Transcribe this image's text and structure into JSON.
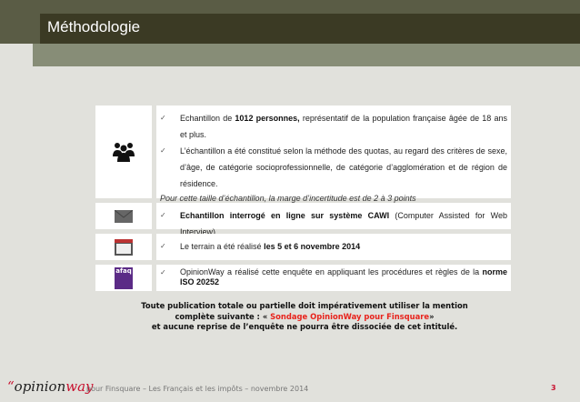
{
  "header": {
    "title": "Méthodologie"
  },
  "rows": [
    {
      "icon": "people-icon",
      "items": [
        {
          "pre": "Echantillon de ",
          "bold": "1012 personnes,",
          "post": " représentatif de la population française âgée de 18 ans et plus."
        },
        {
          "pre": "L’échantillon a été constitué selon la méthode des quotas, au regard des critères de sexe, d’âge, de catégorie socioprofessionnelle, de catégorie d’agglomération et de région de résidence.",
          "bold": "",
          "post": ""
        }
      ],
      "note": "Pour cette taille d’échantillon, la marge d’incertitude est de 2 à 3 points"
    },
    {
      "icon": "envelope-icon",
      "items": [
        {
          "pre": "",
          "bold": "Echantillon interrogé en ligne sur système CAWI",
          "post": " (Computer Assisted for Web Interview)"
        }
      ]
    },
    {
      "icon": "calendar-icon",
      "items": [
        {
          "pre": "Le terrain a été réalisé ",
          "bold": "les 5 et 6 novembre 2014",
          "post": ""
        }
      ]
    },
    {
      "icon": "afaq-certification-logo",
      "logo_text": "afaq",
      "items": [
        {
          "pre": "OpinionWay a réalisé cette enquête en appliquant les procédures et règles de la ",
          "bold": "norme ISO 20252",
          "post": ""
        }
      ]
    }
  ],
  "notice": {
    "line1": "Toute publication totale ou partielle doit impérativement utiliser la mention",
    "line2_pre": "complète suivante : « ",
    "line2_red": "Sondage OpinionWay pour Finsquare",
    "line2_post": "»",
    "line3": "et aucune reprise de l’enquête ne pourra être dissociée de cet intitulé."
  },
  "footer": {
    "logo_quote": "“",
    "logo_a": "opinion",
    "logo_b": "way",
    "text": "pour Finsquare – Les Français et les impôts – novembre 2014",
    "page": "3"
  },
  "check": "✓",
  "colors": {
    "accent_red": "#e8231c",
    "title_bar": "#3b3a24"
  }
}
